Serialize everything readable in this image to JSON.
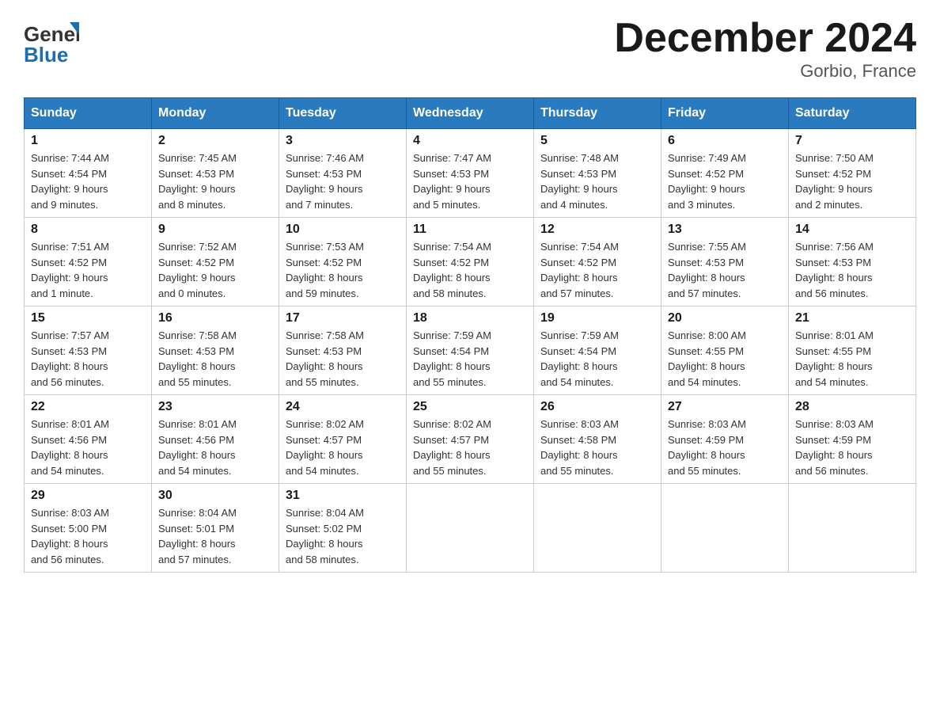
{
  "header": {
    "logo_general": "General",
    "logo_blue": "Blue",
    "title": "December 2024",
    "location": "Gorbio, France"
  },
  "days_of_week": [
    "Sunday",
    "Monday",
    "Tuesday",
    "Wednesday",
    "Thursday",
    "Friday",
    "Saturday"
  ],
  "weeks": [
    [
      {
        "day": "1",
        "sunrise": "7:44 AM",
        "sunset": "4:54 PM",
        "daylight": "9 hours and 9 minutes."
      },
      {
        "day": "2",
        "sunrise": "7:45 AM",
        "sunset": "4:53 PM",
        "daylight": "9 hours and 8 minutes."
      },
      {
        "day": "3",
        "sunrise": "7:46 AM",
        "sunset": "4:53 PM",
        "daylight": "9 hours and 7 minutes."
      },
      {
        "day": "4",
        "sunrise": "7:47 AM",
        "sunset": "4:53 PM",
        "daylight": "9 hours and 5 minutes."
      },
      {
        "day": "5",
        "sunrise": "7:48 AM",
        "sunset": "4:53 PM",
        "daylight": "9 hours and 4 minutes."
      },
      {
        "day": "6",
        "sunrise": "7:49 AM",
        "sunset": "4:52 PM",
        "daylight": "9 hours and 3 minutes."
      },
      {
        "day": "7",
        "sunrise": "7:50 AM",
        "sunset": "4:52 PM",
        "daylight": "9 hours and 2 minutes."
      }
    ],
    [
      {
        "day": "8",
        "sunrise": "7:51 AM",
        "sunset": "4:52 PM",
        "daylight": "9 hours and 1 minute."
      },
      {
        "day": "9",
        "sunrise": "7:52 AM",
        "sunset": "4:52 PM",
        "daylight": "9 hours and 0 minutes."
      },
      {
        "day": "10",
        "sunrise": "7:53 AM",
        "sunset": "4:52 PM",
        "daylight": "8 hours and 59 minutes."
      },
      {
        "day": "11",
        "sunrise": "7:54 AM",
        "sunset": "4:52 PM",
        "daylight": "8 hours and 58 minutes."
      },
      {
        "day": "12",
        "sunrise": "7:54 AM",
        "sunset": "4:52 PM",
        "daylight": "8 hours and 57 minutes."
      },
      {
        "day": "13",
        "sunrise": "7:55 AM",
        "sunset": "4:53 PM",
        "daylight": "8 hours and 57 minutes."
      },
      {
        "day": "14",
        "sunrise": "7:56 AM",
        "sunset": "4:53 PM",
        "daylight": "8 hours and 56 minutes."
      }
    ],
    [
      {
        "day": "15",
        "sunrise": "7:57 AM",
        "sunset": "4:53 PM",
        "daylight": "8 hours and 56 minutes."
      },
      {
        "day": "16",
        "sunrise": "7:58 AM",
        "sunset": "4:53 PM",
        "daylight": "8 hours and 55 minutes."
      },
      {
        "day": "17",
        "sunrise": "7:58 AM",
        "sunset": "4:53 PM",
        "daylight": "8 hours and 55 minutes."
      },
      {
        "day": "18",
        "sunrise": "7:59 AM",
        "sunset": "4:54 PM",
        "daylight": "8 hours and 55 minutes."
      },
      {
        "day": "19",
        "sunrise": "7:59 AM",
        "sunset": "4:54 PM",
        "daylight": "8 hours and 54 minutes."
      },
      {
        "day": "20",
        "sunrise": "8:00 AM",
        "sunset": "4:55 PM",
        "daylight": "8 hours and 54 minutes."
      },
      {
        "day": "21",
        "sunrise": "8:01 AM",
        "sunset": "4:55 PM",
        "daylight": "8 hours and 54 minutes."
      }
    ],
    [
      {
        "day": "22",
        "sunrise": "8:01 AM",
        "sunset": "4:56 PM",
        "daylight": "8 hours and 54 minutes."
      },
      {
        "day": "23",
        "sunrise": "8:01 AM",
        "sunset": "4:56 PM",
        "daylight": "8 hours and 54 minutes."
      },
      {
        "day": "24",
        "sunrise": "8:02 AM",
        "sunset": "4:57 PM",
        "daylight": "8 hours and 54 minutes."
      },
      {
        "day": "25",
        "sunrise": "8:02 AM",
        "sunset": "4:57 PM",
        "daylight": "8 hours and 55 minutes."
      },
      {
        "day": "26",
        "sunrise": "8:03 AM",
        "sunset": "4:58 PM",
        "daylight": "8 hours and 55 minutes."
      },
      {
        "day": "27",
        "sunrise": "8:03 AM",
        "sunset": "4:59 PM",
        "daylight": "8 hours and 55 minutes."
      },
      {
        "day": "28",
        "sunrise": "8:03 AM",
        "sunset": "4:59 PM",
        "daylight": "8 hours and 56 minutes."
      }
    ],
    [
      {
        "day": "29",
        "sunrise": "8:03 AM",
        "sunset": "5:00 PM",
        "daylight": "8 hours and 56 minutes."
      },
      {
        "day": "30",
        "sunrise": "8:04 AM",
        "sunset": "5:01 PM",
        "daylight": "8 hours and 57 minutes."
      },
      {
        "day": "31",
        "sunrise": "8:04 AM",
        "sunset": "5:02 PM",
        "daylight": "8 hours and 58 minutes."
      },
      null,
      null,
      null,
      null
    ]
  ],
  "labels": {
    "sunrise": "Sunrise:",
    "sunset": "Sunset:",
    "daylight": "Daylight:"
  }
}
